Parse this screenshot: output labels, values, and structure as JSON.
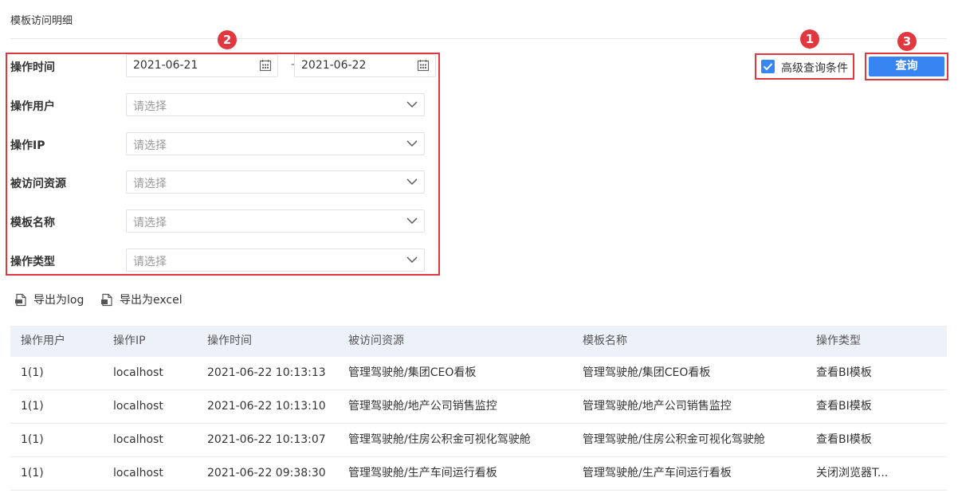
{
  "page": {
    "title": "模板访问明细"
  },
  "filters": {
    "time_label": "操作时间",
    "date_from": "2021-06-21",
    "date_sep": "-",
    "date_to": "2021-06-22",
    "user_label": "操作用户",
    "ip_label": "操作IP",
    "resource_label": "被访问资源",
    "template_label": "模板名称",
    "type_label": "操作类型",
    "placeholder": "请选择"
  },
  "advanced": {
    "label": "高级查询条件",
    "checked": true
  },
  "query": {
    "label": "查询"
  },
  "badges": {
    "b1": "1",
    "b2": "2",
    "b3": "3"
  },
  "export": {
    "log": "导出为log",
    "excel": "导出为excel"
  },
  "table": {
    "headers": [
      "操作用户",
      "操作IP",
      "操作时间",
      "被访问资源",
      "模板名称",
      "操作类型"
    ],
    "rows": [
      [
        "1(1)",
        "localhost",
        "2021-06-22 10:13:13",
        "管理驾驶舱/集团CEO看板",
        "管理驾驶舱/集团CEO看板",
        "查看BI模板"
      ],
      [
        "1(1)",
        "localhost",
        "2021-06-22 10:13:10",
        "管理驾驶舱/地产公司销售监控",
        "管理驾驶舱/地产公司销售监控",
        "查看BI模板"
      ],
      [
        "1(1)",
        "localhost",
        "2021-06-22 10:13:07",
        "管理驾驶舱/住房公积金可视化驾驶舱",
        "管理驾驶舱/住房公积金可视化驾驶舱",
        "查看BI模板"
      ],
      [
        "1(1)",
        "localhost",
        "2021-06-22 09:38:30",
        "管理驾驶舱/生产车间运行看板",
        "管理驾驶舱/生产车间运行看板",
        "关闭浏览器T..."
      ]
    ]
  },
  "colors": {
    "accent": "#3685f2",
    "highlight": "#e0383e",
    "header_bg": "#edf2fa"
  },
  "icons": {
    "calendar": "calendar-icon",
    "chevron": "chevron-down-icon",
    "check": "checkbox-checked-icon",
    "export": "export-file-icon"
  }
}
